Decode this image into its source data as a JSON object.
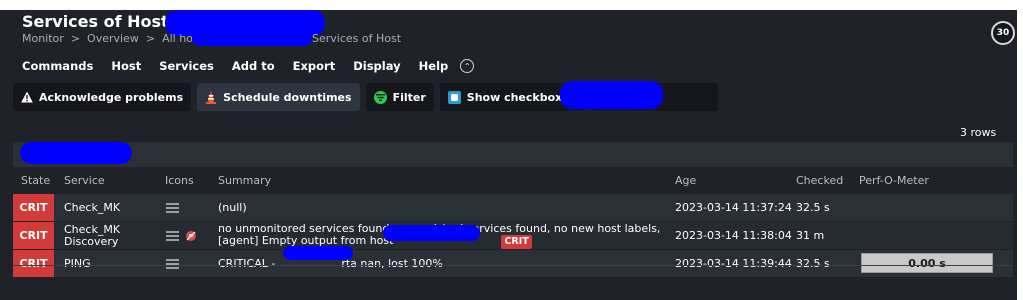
{
  "header": {
    "title": "Services of Host",
    "breadcrumb": [
      "Monitor",
      "Overview",
      "All hosts"
    ],
    "breadcrumb_tail": "Services of Host",
    "refresh_seconds": "30"
  },
  "menu": [
    "Commands",
    "Host",
    "Services",
    "Add to",
    "Export",
    "Display",
    "Help"
  ],
  "toolbar": {
    "acknowledge": "Acknowledge problems",
    "schedule": "Schedule downtimes",
    "filter": "Filter",
    "checkboxes": "Show checkboxes"
  },
  "row_count": "3 rows",
  "table": {
    "headers": [
      "State",
      "Service",
      "Icons",
      "Summary",
      "Age",
      "Checked",
      "Perf-O-Meter"
    ],
    "rows": [
      {
        "state": "CRIT",
        "service": "Check_MK",
        "summary": "(null)",
        "age": "2023-03-14 11:37:24",
        "checked": "32.5 s"
      },
      {
        "state": "CRIT",
        "service_line1": "Check_MK",
        "service_line2": "Discovery",
        "summary_line1": "no unmonitored services found, no vanished services found, no new host labels,",
        "summary_line2": "[agent] Empty output from host",
        "summary_badge": "CRIT",
        "age": "2023-03-14 11:38:04",
        "checked": "31 m"
      },
      {
        "state": "CRIT",
        "service": "PING",
        "summary_prefix": "CRITICAL -",
        "summary_suffix": "rta nan, lost 100%",
        "age": "2023-03-14 11:39:44",
        "checked": "32.5 s",
        "perf": "0.00 s"
      }
    ]
  },
  "colors": {
    "background": "#1f2229",
    "crit": "#d33a3a",
    "redaction": "#0000ff"
  }
}
